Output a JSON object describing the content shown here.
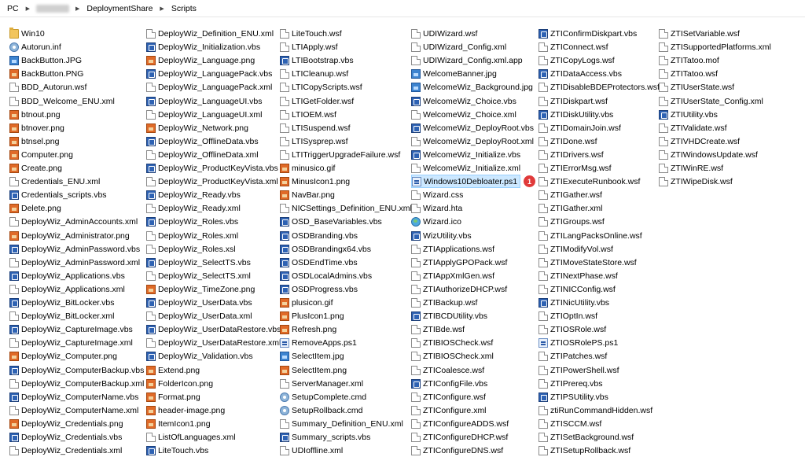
{
  "breadcrumb": {
    "items": [
      "PC",
      "DeploymentShare",
      "Scripts"
    ]
  },
  "badge": {
    "text": "1"
  },
  "columns": [
    [
      [
        "folder",
        "Win10"
      ],
      [
        "gear",
        "Autorun.inf"
      ],
      [
        "img-blue",
        "BackButton.JPG"
      ],
      [
        "img",
        "BackButton.PNG"
      ],
      [
        "doc",
        "BDD_Autorun.wsf"
      ],
      [
        "doc",
        "BDD_Welcome_ENU.xml"
      ],
      [
        "img",
        "btnout.png"
      ],
      [
        "img",
        "btnover.png"
      ],
      [
        "img",
        "btnsel.png"
      ],
      [
        "img",
        "Computer.png"
      ],
      [
        "img",
        "Create.png"
      ],
      [
        "doc",
        "Credentials_ENU.xml"
      ],
      [
        "vbs",
        "Credentials_scripts.vbs"
      ],
      [
        "img",
        "Delete.png"
      ],
      [
        "doc",
        "DeployWiz_AdminAccounts.xml"
      ],
      [
        "img",
        "DeployWiz_Administrator.png"
      ],
      [
        "vbs",
        "DeployWiz_AdminPassword.vbs"
      ],
      [
        "doc",
        "DeployWiz_AdminPassword.xml"
      ],
      [
        "vbs",
        "DeployWiz_Applications.vbs"
      ],
      [
        "doc",
        "DeployWiz_Applications.xml"
      ],
      [
        "vbs",
        "DeployWiz_BitLocker.vbs"
      ],
      [
        "doc",
        "DeployWiz_BitLocker.xml"
      ],
      [
        "vbs",
        "DeployWiz_CaptureImage.vbs"
      ],
      [
        "doc",
        "DeployWiz_CaptureImage.xml"
      ],
      [
        "img",
        "DeployWiz_Computer.png"
      ],
      [
        "vbs",
        "DeployWiz_ComputerBackup.vbs"
      ],
      [
        "doc",
        "DeployWiz_ComputerBackup.xml"
      ],
      [
        "vbs",
        "DeployWiz_ComputerName.vbs"
      ],
      [
        "doc",
        "DeployWiz_ComputerName.xml"
      ],
      [
        "img",
        "DeployWiz_Credentials.png"
      ],
      [
        "vbs",
        "DeployWiz_Credentials.vbs"
      ],
      [
        "doc",
        "DeployWiz_Credentials.xml"
      ]
    ],
    [
      [
        "doc",
        "DeployWiz_Definition_ENU.xml"
      ],
      [
        "vbs",
        "DeployWiz_Initialization.vbs"
      ],
      [
        "img",
        "DeployWiz_Language.png"
      ],
      [
        "vbs",
        "DeployWiz_LanguagePack.vbs"
      ],
      [
        "doc",
        "DeployWiz_LanguagePack.xml"
      ],
      [
        "vbs",
        "DeployWiz_LanguageUI.vbs"
      ],
      [
        "doc",
        "DeployWiz_LanguageUI.xml"
      ],
      [
        "img",
        "DeployWiz_Network.png"
      ],
      [
        "vbs",
        "DeployWiz_OfflineData.vbs"
      ],
      [
        "doc",
        "DeployWiz_OfflineData.xml"
      ],
      [
        "vbs",
        "DeployWiz_ProductKeyVista.vbs"
      ],
      [
        "doc",
        "DeployWiz_ProductKeyVista.xml"
      ],
      [
        "vbs",
        "DeployWiz_Ready.vbs"
      ],
      [
        "doc",
        "DeployWiz_Ready.xml"
      ],
      [
        "vbs",
        "DeployWiz_Roles.vbs"
      ],
      [
        "doc",
        "DeployWiz_Roles.xml"
      ],
      [
        "doc",
        "DeployWiz_Roles.xsl"
      ],
      [
        "vbs",
        "DeployWiz_SelectTS.vbs"
      ],
      [
        "doc",
        "DeployWiz_SelectTS.xml"
      ],
      [
        "img",
        "DeployWiz_TimeZone.png"
      ],
      [
        "vbs",
        "DeployWiz_UserData.vbs"
      ],
      [
        "doc",
        "DeployWiz_UserData.xml"
      ],
      [
        "vbs",
        "DeployWiz_UserDataRestore.vbs"
      ],
      [
        "doc",
        "DeployWiz_UserDataRestore.xml"
      ],
      [
        "vbs",
        "DeployWiz_Validation.vbs"
      ],
      [
        "img",
        "Extend.png"
      ],
      [
        "img",
        "FolderIcon.png"
      ],
      [
        "img",
        "Format.png"
      ],
      [
        "img",
        "header-image.png"
      ],
      [
        "img",
        "ItemIcon1.png"
      ],
      [
        "doc",
        "ListOfLanguages.xml"
      ],
      [
        "vbs",
        "LiteTouch.vbs"
      ]
    ],
    [
      [
        "doc",
        "LiteTouch.wsf"
      ],
      [
        "doc",
        "LTIApply.wsf"
      ],
      [
        "vbs",
        "LTIBootstrap.vbs"
      ],
      [
        "doc",
        "LTICleanup.wsf"
      ],
      [
        "doc",
        "LTICopyScripts.wsf"
      ],
      [
        "doc",
        "LTIGetFolder.wsf"
      ],
      [
        "doc",
        "LTIOEM.wsf"
      ],
      [
        "doc",
        "LTISuspend.wsf"
      ],
      [
        "doc",
        "LTISysprep.wsf"
      ],
      [
        "doc",
        "LTITriggerUpgradeFailure.wsf"
      ],
      [
        "img",
        "minusico.gif"
      ],
      [
        "img",
        "MinusIcon1.png"
      ],
      [
        "img",
        "NavBar.png"
      ],
      [
        "doc",
        "NICSettings_Definition_ENU.xml"
      ],
      [
        "vbs",
        "OSD_BaseVariables.vbs"
      ],
      [
        "vbs",
        "OSDBranding.vbs"
      ],
      [
        "vbs",
        "OSDBrandingx64.vbs"
      ],
      [
        "vbs",
        "OSDEndTime.vbs"
      ],
      [
        "vbs",
        "OSDLocalAdmins.vbs"
      ],
      [
        "vbs",
        "OSDProgress.vbs"
      ],
      [
        "img",
        "plusicon.gif"
      ],
      [
        "img",
        "PlusIcon1.png"
      ],
      [
        "img",
        "Refresh.png"
      ],
      [
        "ps1",
        "RemoveApps.ps1"
      ],
      [
        "img-blue",
        "SelectItem.jpg"
      ],
      [
        "img",
        "SelectItem.png"
      ],
      [
        "doc",
        "ServerManager.xml"
      ],
      [
        "gear",
        "SetupComplete.cmd"
      ],
      [
        "gear",
        "SetupRollback.cmd"
      ],
      [
        "doc",
        "Summary_Definition_ENU.xml"
      ],
      [
        "vbs",
        "Summary_scripts.vbs"
      ],
      [
        "doc",
        "UDIoffline.xml"
      ]
    ],
    [
      [
        "doc",
        "UDIWizard.wsf"
      ],
      [
        "doc",
        "UDIWizard_Config.xml"
      ],
      [
        "doc",
        "UDIWizard_Config.xml.app"
      ],
      [
        "img-blue",
        "WelcomeBanner.jpg"
      ],
      [
        "img-blue",
        "WelcomeWiz_Background.jpg"
      ],
      [
        "vbs",
        "WelcomeWiz_Choice.vbs"
      ],
      [
        "doc",
        "WelcomeWiz_Choice.xml"
      ],
      [
        "vbs",
        "WelcomeWiz_DeployRoot.vbs"
      ],
      [
        "doc",
        "WelcomeWiz_DeployRoot.xml"
      ],
      [
        "vbs",
        "WelcomeWiz_Initialize.vbs"
      ],
      [
        "doc",
        "WelcomeWiz_Initialize.xml"
      ],
      [
        "ps1",
        "Windows10Debloater.ps1"
      ],
      [
        "doc",
        "Wizard.css"
      ],
      [
        "doc",
        "Wizard.hta"
      ],
      [
        "globe",
        "Wizard.ico"
      ],
      [
        "vbs",
        "WizUtility.vbs"
      ],
      [
        "doc",
        "ZTIApplications.wsf"
      ],
      [
        "doc",
        "ZTIApplyGPOPack.wsf"
      ],
      [
        "doc",
        "ZTIAppXmlGen.wsf"
      ],
      [
        "doc",
        "ZTIAuthorizeDHCP.wsf"
      ],
      [
        "doc",
        "ZTIBackup.wsf"
      ],
      [
        "vbs",
        "ZTIBCDUtility.vbs"
      ],
      [
        "doc",
        "ZTIBde.wsf"
      ],
      [
        "doc",
        "ZTIBIOSCheck.wsf"
      ],
      [
        "doc",
        "ZTIBIOSCheck.xml"
      ],
      [
        "doc",
        "ZTICoalesce.wsf"
      ],
      [
        "vbs",
        "ZTIConfigFile.vbs"
      ],
      [
        "doc",
        "ZTIConfigure.wsf"
      ],
      [
        "doc",
        "ZTIConfigure.xml"
      ],
      [
        "doc",
        "ZTIConfigureADDS.wsf"
      ],
      [
        "doc",
        "ZTIConfigureDHCP.wsf"
      ],
      [
        "doc",
        "ZTIConfigureDNS.wsf"
      ]
    ],
    [
      [
        "vbs",
        "ZTIConfirmDiskpart.vbs"
      ],
      [
        "doc",
        "ZTIConnect.wsf"
      ],
      [
        "doc",
        "ZTICopyLogs.wsf"
      ],
      [
        "vbs",
        "ZTIDataAccess.vbs"
      ],
      [
        "doc",
        "ZTIDisableBDEProtectors.wsf"
      ],
      [
        "doc",
        "ZTIDiskpart.wsf"
      ],
      [
        "vbs",
        "ZTIDiskUtility.vbs"
      ],
      [
        "doc",
        "ZTIDomainJoin.wsf"
      ],
      [
        "doc",
        "ZTIDone.wsf"
      ],
      [
        "doc",
        "ZTIDrivers.wsf"
      ],
      [
        "doc",
        "ZTIErrorMsg.wsf"
      ],
      [
        "doc",
        "ZTIExecuteRunbook.wsf"
      ],
      [
        "doc",
        "ZTIGather.wsf"
      ],
      [
        "doc",
        "ZTIGather.xml"
      ],
      [
        "doc",
        "ZTIGroups.wsf"
      ],
      [
        "doc",
        "ZTILangPacksOnline.wsf"
      ],
      [
        "doc",
        "ZTIModifyVol.wsf"
      ],
      [
        "doc",
        "ZTIMoveStateStore.wsf"
      ],
      [
        "doc",
        "ZTINextPhase.wsf"
      ],
      [
        "doc",
        "ZTINICConfig.wsf"
      ],
      [
        "vbs",
        "ZTINicUtility.vbs"
      ],
      [
        "doc",
        "ZTIOptIn.wsf"
      ],
      [
        "doc",
        "ZTIOSRole.wsf"
      ],
      [
        "ps1",
        "ZTIOSRolePS.ps1"
      ],
      [
        "doc",
        "ZTIPatches.wsf"
      ],
      [
        "doc",
        "ZTIPowerShell.wsf"
      ],
      [
        "doc",
        "ZTIPrereq.vbs"
      ],
      [
        "vbs",
        "ZTIPSUtility.vbs"
      ],
      [
        "doc",
        "ztiRunCommandHidden.wsf"
      ],
      [
        "doc",
        "ZTISCCM.wsf"
      ],
      [
        "doc",
        "ZTISetBackground.wsf"
      ],
      [
        "doc",
        "ZTISetupRollback.wsf"
      ]
    ],
    [
      [
        "doc",
        "ZTISetVariable.wsf"
      ],
      [
        "doc",
        "ZTISupportedPlatforms.xml"
      ],
      [
        "doc",
        "ZTITatoo.mof"
      ],
      [
        "doc",
        "ZTITatoo.wsf"
      ],
      [
        "doc",
        "ZTIUserState.wsf"
      ],
      [
        "doc",
        "ZTIUserState_Config.xml"
      ],
      [
        "vbs",
        "ZTIUtility.vbs"
      ],
      [
        "doc",
        "ZTIValidate.wsf"
      ],
      [
        "doc",
        "ZTIVHDCreate.wsf"
      ],
      [
        "doc",
        "ZTIWindowsUpdate.wsf"
      ],
      [
        "doc",
        "ZTIWinRE.wsf"
      ],
      [
        "doc",
        "ZTIWipeDisk.wsf"
      ]
    ]
  ],
  "selected": {
    "col": 3,
    "row": 11
  }
}
